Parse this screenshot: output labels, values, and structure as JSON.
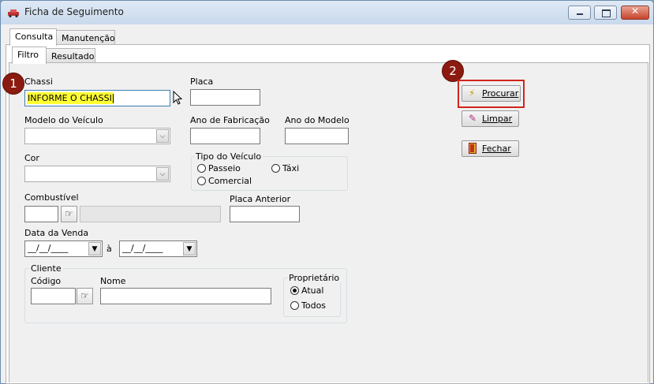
{
  "window": {
    "title": "Ficha de Seguimento",
    "controls": {
      "minimize": "–",
      "maximize": "□",
      "close": "✕"
    }
  },
  "outer_tabs": [
    {
      "label": "Consulta",
      "active": true
    },
    {
      "label": "Manutenção",
      "active": false
    }
  ],
  "inner_tabs": [
    {
      "label": "Filtro",
      "active": true
    },
    {
      "label": "Resultado",
      "active": false
    }
  ],
  "badges": {
    "step1": "1",
    "step2": "2"
  },
  "form": {
    "chassi": {
      "label": "Chassi",
      "value": "INFORME O CHASSI"
    },
    "placa": {
      "label": "Placa",
      "value": ""
    },
    "modelo_veiculo": {
      "label": "Modelo do Veículo",
      "value": ""
    },
    "ano_fabricacao": {
      "label": "Ano de Fabricação",
      "value": ""
    },
    "ano_modelo": {
      "label": "Ano do Modelo",
      "value": ""
    },
    "cor": {
      "label": "Cor",
      "value": ""
    },
    "tipo_veiculo": {
      "label": "Tipo do Veículo",
      "options": [
        "Passeio",
        "Táxi",
        "Comercial"
      ],
      "selected": ""
    },
    "combustivel": {
      "label": "Combustível",
      "code": "",
      "description": ""
    },
    "placa_anterior": {
      "label": "Placa Anterior",
      "value": ""
    },
    "data_venda": {
      "label": "Data da Venda",
      "from": "__/__/____",
      "separator": "à",
      "to": "__/__/____"
    },
    "cliente": {
      "label": "Cliente",
      "codigo_label": "Código",
      "codigo_value": "",
      "nome_label": "Nome",
      "nome_value": "",
      "proprietario": {
        "label": "Proprietário",
        "options": [
          "Atual",
          "Todos"
        ],
        "selected": "Atual"
      }
    }
  },
  "buttons": {
    "procurar": "Procurar",
    "limpar": "Limpar",
    "fechar": "Fechar"
  },
  "icons": {
    "procurar": "lightning-icon",
    "limpar": "eraser-icon",
    "fechar": "exit-door-icon",
    "lookup": "pointing-hand-icon"
  },
  "colors": {
    "badge": "#8b1a10",
    "highlight_border": "#d0261c",
    "chassi_highlight": "#ffff33"
  }
}
